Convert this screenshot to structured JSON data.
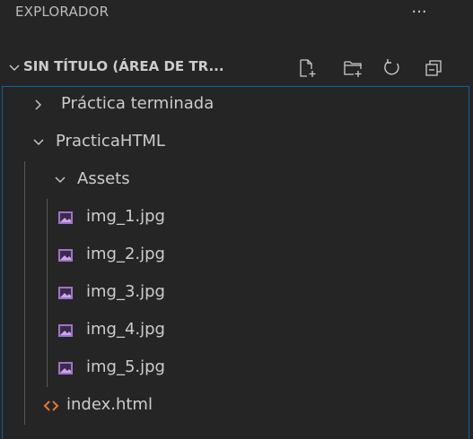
{
  "header": {
    "title": "EXPLORADOR",
    "more_label": "..."
  },
  "section": {
    "title": "SIN TÍTULO (ÁREA DE TR...",
    "actions": [
      "new-file-icon",
      "new-folder-icon",
      "refresh-icon",
      "collapse-all-icon"
    ]
  },
  "tree": {
    "items": [
      {
        "label": "Práctica terminada",
        "type": "folder",
        "expanded": false
      },
      {
        "label": "PracticaHTML",
        "type": "folder",
        "expanded": true
      },
      {
        "label": "Assets",
        "type": "folder",
        "expanded": true
      },
      {
        "label": "img_1.jpg",
        "type": "image"
      },
      {
        "label": "img_2.jpg",
        "type": "image"
      },
      {
        "label": "img_3.jpg",
        "type": "image"
      },
      {
        "label": "img_4.jpg",
        "type": "image"
      },
      {
        "label": "img_5.jpg",
        "type": "image"
      },
      {
        "label": "index.html",
        "type": "html"
      }
    ]
  },
  "colors": {
    "background": "#252526",
    "text": "#cccccc",
    "focus_border": "#0e639c",
    "image_icon": "#a074c4",
    "html_icon": "#e37933"
  }
}
